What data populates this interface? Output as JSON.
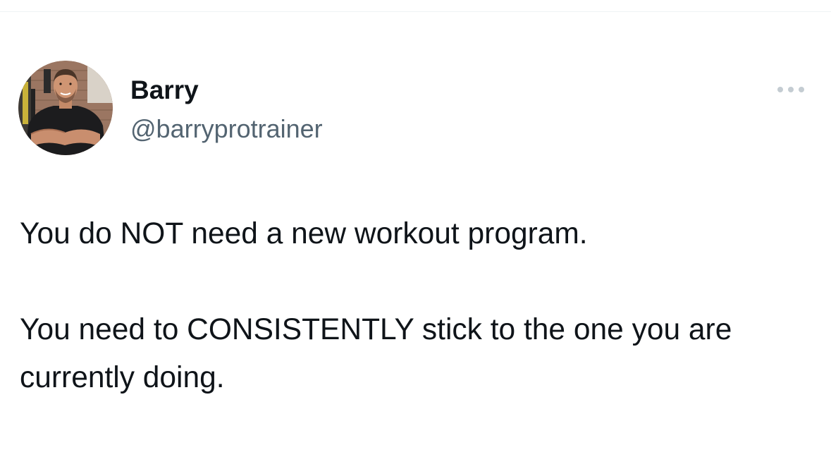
{
  "tweet": {
    "author": {
      "display_name": "Barry",
      "handle": "@barryprotrainer",
      "avatar_icon": "profile-photo-avatar"
    },
    "more_icon": "more-options-ellipsis-icon",
    "paragraphs": [
      "You do NOT need a new workout program.",
      "You need to CONSISTENTLY stick to the one you are currently doing."
    ]
  },
  "colors": {
    "text_primary": "#0f1419",
    "text_secondary": "#536471",
    "icon_muted": "#b9c3ca",
    "divider": "#eff3f4"
  }
}
